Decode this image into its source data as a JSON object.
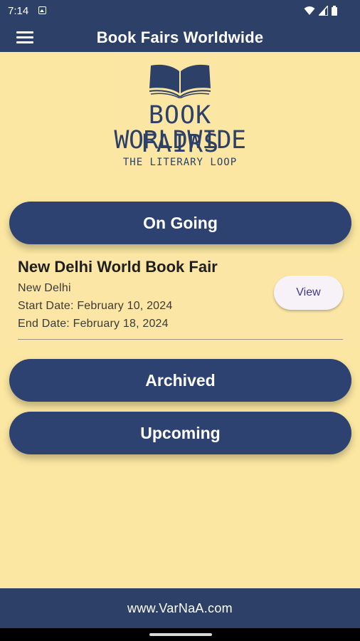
{
  "status_bar": {
    "time": "7:14"
  },
  "app_bar": {
    "title": "Book Fairs Worldwide"
  },
  "logo": {
    "line1": "BOOK FAIRS",
    "line2": "WORLDWIDE",
    "line3": "THE LITERARY LOOP"
  },
  "sections": {
    "ongoing_label": "On Going",
    "archived_label": "Archived",
    "upcoming_label": "Upcoming"
  },
  "ongoing_fairs": [
    {
      "name": "New Delhi World Book Fair",
      "location": "New Delhi",
      "start": "Start Date: February 10, 2024",
      "end": "End Date: February 18, 2024",
      "view_label": "View"
    }
  ],
  "footer": {
    "text": "www.VarNaA.com"
  },
  "colors": {
    "primary": "#2c4068",
    "background": "#fbe7a1",
    "button": "#2e4271",
    "view_text": "#3e3a8c"
  },
  "icons": {
    "menu": "hamburger-menu-icon",
    "wifi": "wifi-icon",
    "signal": "signal-icon",
    "battery": "battery-icon",
    "notification": "notification-icon"
  }
}
